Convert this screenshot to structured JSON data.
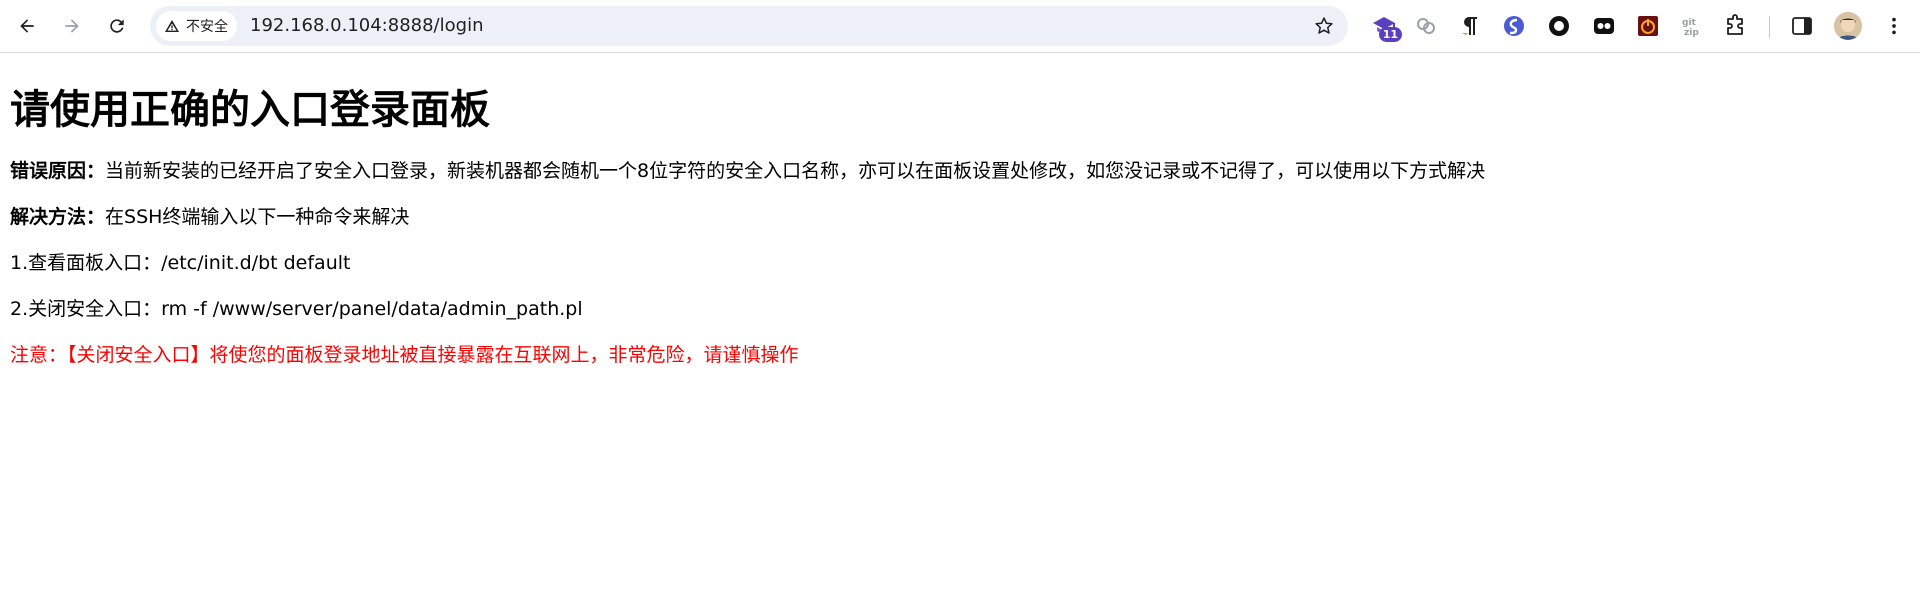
{
  "browser": {
    "security_label": "不安全",
    "url": "192.168.0.104:8888/login",
    "extensions": [
      {
        "name": "graduation-cap-extension-icon",
        "badge": "11",
        "color": "#5b3fbf"
      },
      {
        "name": "link-circles-extension-icon",
        "color": "#9aa0a6"
      },
      {
        "name": "pilcrow-extension-icon",
        "color": "#1f1f1f"
      },
      {
        "name": "s-shape-extension-icon",
        "color": "#4b5bd6"
      },
      {
        "name": "ring-extension-icon",
        "color": "#111111"
      },
      {
        "name": "ghost-extension-icon",
        "color": "#111111"
      },
      {
        "name": "power-extension-icon",
        "color": "#c62828"
      },
      {
        "name": "gitzip-extension-icon",
        "color": "#9aa0a6"
      },
      {
        "name": "puzzle-extensions-icon",
        "color": "#1f1f1f"
      }
    ]
  },
  "page": {
    "title": "请使用正确的入口登录面板",
    "reason_label": "错误原因：",
    "reason_text": "当前新安装的已经开启了安全入口登录，新装机器都会随机一个8位字符的安全入口名称，亦可以在面板设置处修改，如您没记录或不记得了，可以使用以下方式解决",
    "solution_label": "解决方法：",
    "solution_text": "在SSH终端输入以下一种命令来解决",
    "step1": "1.查看面板入口：/etc/init.d/bt default",
    "step2": "2.关闭安全入口：rm -f /www/server/panel/data/admin_path.pl",
    "warning": "注意：【关闭安全入口】将使您的面板登录地址被直接暴露在互联网上，非常危险，请谨慎操作",
    "warning_color": "#ff0000"
  }
}
